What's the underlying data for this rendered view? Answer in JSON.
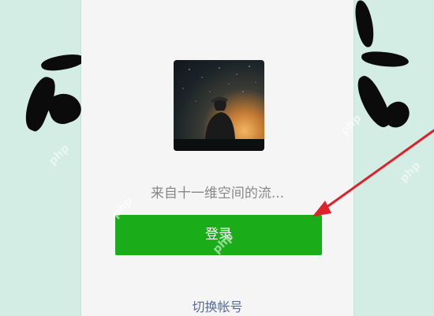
{
  "colors": {
    "background": "#d3ece4",
    "panel": "#f5f5f5",
    "login_button": "#1aad19",
    "link": "#576b95",
    "annotation_arrow": "#e0202a"
  },
  "profile": {
    "avatar_icon": "user-avatar-stargazer-photo",
    "nickname": "来自十一维空间的流..."
  },
  "actions": {
    "login_label": "登录",
    "switch_account_label": "切换帐号"
  },
  "watermarks": [
    "php",
    "php",
    "php",
    "php",
    "php"
  ],
  "annotation": {
    "arrow_icon": "red-arrow-pointing-to-login-button"
  }
}
